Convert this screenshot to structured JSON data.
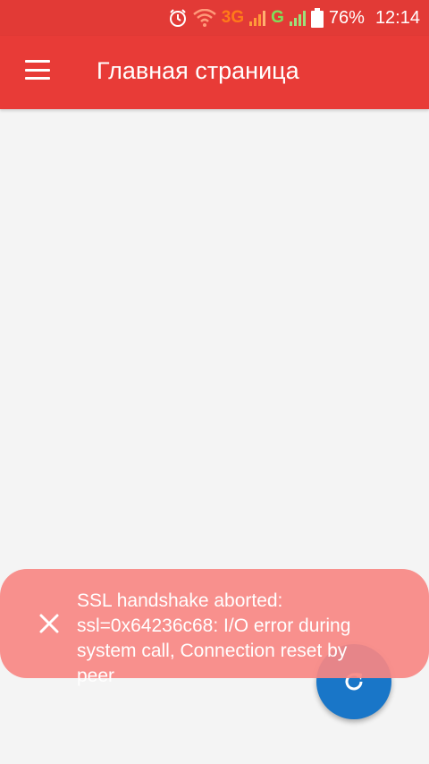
{
  "status_bar": {
    "network_3g": "3G",
    "network_g": "G",
    "battery": "76%",
    "time": "12:14"
  },
  "app_bar": {
    "title": "Главная страница"
  },
  "snackbar": {
    "message": "SSL handshake aborted: ssl=0x64236c68: I/O error during system call, Connection reset by peer"
  },
  "colors": {
    "app_bar": "#e83b37",
    "snackbar": "#f78783",
    "fab": "#1976c8"
  }
}
